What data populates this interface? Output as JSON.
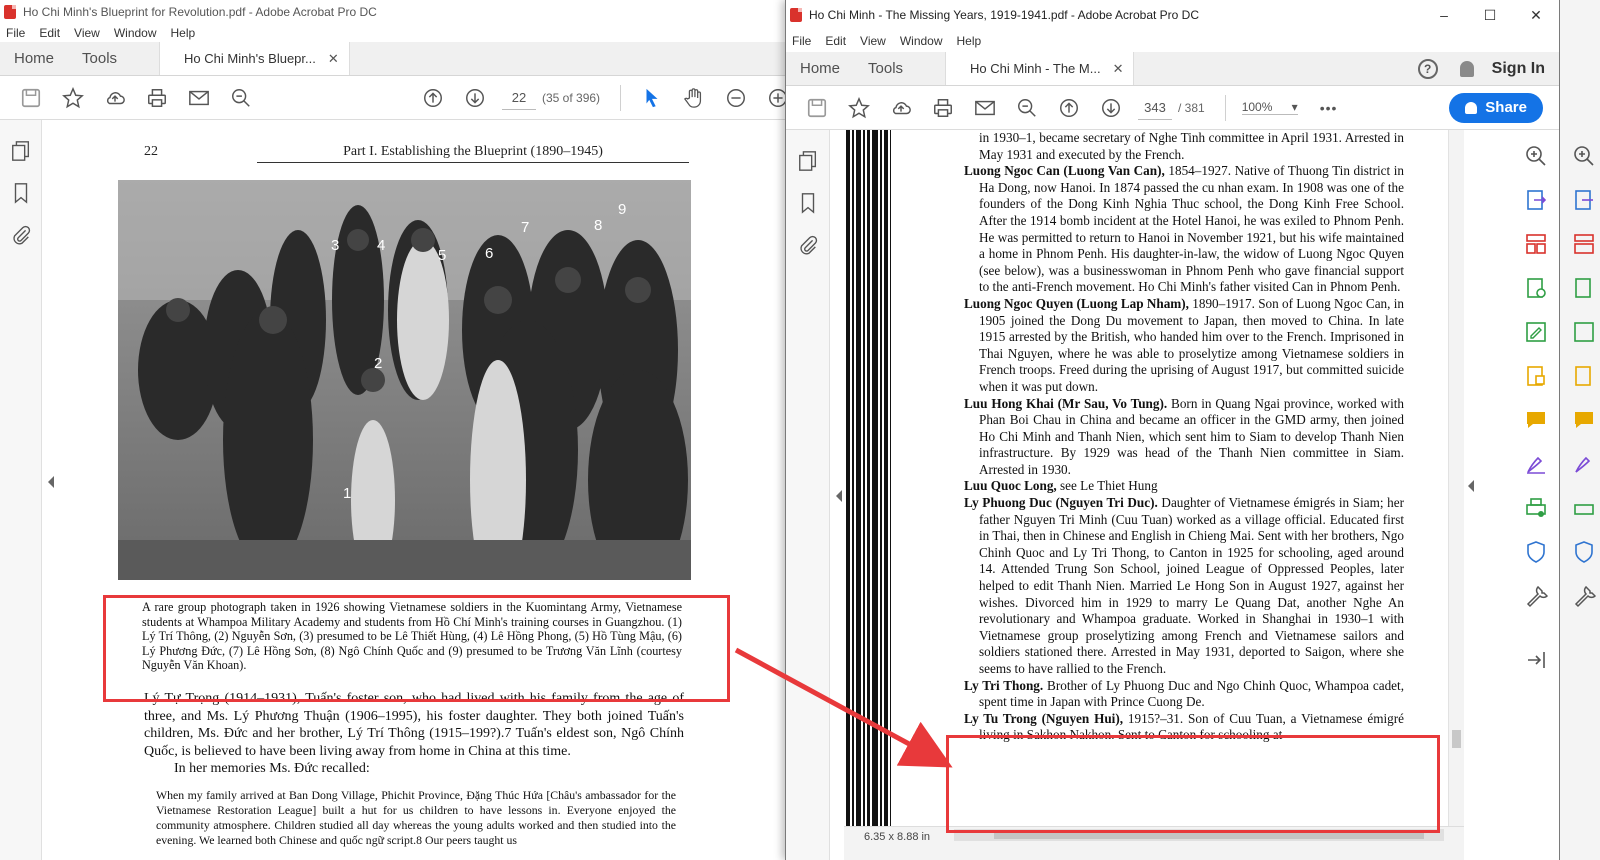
{
  "left_window": {
    "title": "Ho Chi Minh's Blueprint for Revolution.pdf - Adobe Acrobat Pro DC",
    "menu": [
      "File",
      "Edit",
      "View",
      "Window",
      "Help"
    ],
    "tabs": {
      "home": "Home",
      "tools": "Tools",
      "document": "Ho Chi Minh's Bluepr..."
    },
    "page_input": "22",
    "page_count": "(35 of 396)",
    "page": {
      "page_number": "22",
      "running_head": "Part I. Establishing the Blueprint (1890–1945)",
      "photo_labels": [
        "1",
        "2",
        "3",
        "4",
        "5",
        "6",
        "7",
        "8",
        "9"
      ],
      "caption": "A rare group photograph taken in 1926 showing Vietnamese soldiers in the Kuomintang Army, Vietnamese students at Whampoa Military Academy and students from Hồ Chí Minh's training courses in Guangzhou. (1) Lý Trí Thông, (2) Nguyễn Sơn, (3) presumed to be Lê Thiết Hùng, (4) Lê Hồng Phong, (5) Hồ Tùng Mậu, (6) Lý Phương Đức, (7) Lê Hồng Sơn, (8) Ngô Chính Quốc and (9) presumed to be Trương Văn Lĩnh (courtesy Nguyễn Văn Khoan).",
      "para1": "Lý Tự Trọng (1914–1931), Tuấn's foster son, who had lived with his family from the age of three, and Ms. Lý Phương Thuận (1906–1995), his foster daughter. They both joined Tuấn's children, Ms. Đức and her brother, Lý Trí Thông (1915–199?).7 Tuấn's eldest son, Ngô Chính Quốc, is believed to have been living away from home in China at this time.",
      "para2": "In her memories Ms. Đức recalled:",
      "quote": "When my family arrived at Ban Dong Village, Phichit Province, Đặng Thúc Hứa [Châu's ambassador for the Vietnamese Restoration League] built a hut for us children to have lessons in. Everyone enjoyed the community atmosphere. Children studied all day whereas the young adults worked and then studied into the evening. We learned both Chinese and quốc ngữ script.8 Our peers taught us"
    }
  },
  "right_window": {
    "title": "Ho Chi Minh - The Missing Years, 1919-1941.pdf - Adobe Acrobat Pro DC",
    "window_controls": [
      "–",
      "☐",
      "✕"
    ],
    "menu": [
      "File",
      "Edit",
      "View",
      "Window",
      "Help"
    ],
    "tabs": {
      "home": "Home",
      "tools": "Tools",
      "document": "Ho Chi Minh - The M..."
    },
    "help_label": "?",
    "sign_in": "Sign In",
    "page_input": "343",
    "page_total": "/ 381",
    "zoom": "100%",
    "more": "•••",
    "share": "Share",
    "page_size": "6.35 x 8.88 in",
    "entries": [
      {
        "head": "",
        "text": "in 1930–1, became secretary of Nghe Tinh committee in April 1931. Arrested in May 1931 and executed by the French."
      },
      {
        "head": "Luong Ngoc Can (Luong Van Can),",
        "text": " 1854–1927. Native of Thuong Tin district in Ha Dong, now Hanoi. In 1874 passed the cu nhan exam. In 1908 was one of the founders of the Dong Kinh Nghia Thuc school, the Dong Kinh Free School. After the 1914 bomb incident at the Hotel Hanoi, he was exiled to Phnom Penh. He was permitted to return to Hanoi in November 1921, but his wife maintained a home in Phnom Penh. His daughter-in-law, the widow of Luong Ngoc Quyen (see below), was a businesswoman in Phnom Penh who gave financial support to the anti-French movement. Ho Chi Minh's father visited Can in Phnom Penh."
      },
      {
        "head": "Luong Ngoc Quyen (Luong Lap Nham),",
        "text": " 1890–1917. Son of Luong Ngoc Can, in 1905 joined the Dong Du movement to Japan, then moved to China. In late 1915 arrested by the British, who handed him over to the French. Imprisoned in Thai Nguyen, where he was able to proselytize among Vietnamese soldiers in French troops. Freed during the uprising of August 1917, but committed suicide when it was put down."
      },
      {
        "head": "Luu Hong Khai (Mr Sau, Vo Tung).",
        "text": " Born in Quang Ngai province, worked with Phan Boi Chau in China and became an officer in the GMD army, then joined Ho Chi Minh and Thanh Nien, which sent him to Siam to develop Thanh Nien infrastructure. By 1929 was head of the Thanh Nien committee in Siam. Arrested in 1930."
      },
      {
        "head": "Luu Quoc Long,",
        "text": " see Le Thiet Hung"
      },
      {
        "head": "Ly Phuong Duc (Nguyen Tri Duc).",
        "text": " Daughter of Vietnamese émigrés in Siam; her father Nguyen Tri Minh (Cuu Tuan) worked as a village official. Educated first in Thai, then in Chinese and English in Chieng Mai. Sent with her brothers, Ngo Chinh Quoc and Ly Tri Thong, to Canton in 1925 for schooling, aged around 14. Attended Trung Son School, joined League of Oppressed Peoples, later helped to edit Thanh Nien. Married Le Hong Son in August 1927, against her wishes. Divorced him in 1929 to marry Le Quang Dat, another Nghe An revolutionary and Whampoa graduate. Worked in Shanghai in 1930–1 with Vietnamese group proselytizing among French and Vietnamese sailors and soldiers stationed there. Arrested in May 1931, deported to Saigon, where she seems to have rallied to the French."
      },
      {
        "head": "Ly Tri Thong.",
        "text": " Brother of Ly Phuong Duc and Ngo Chinh Quoc, Whampoa cadet, spent time in Japan with Prince Cuong De."
      },
      {
        "head": "Ly Tu Trong (Nguyen Hui),",
        "text": " 1915?–31. Son of Cuu Tuan, a Vietnamese émigré living in Sakhon Nakhon. Sent to Canton for schooling at"
      }
    ]
  },
  "colors": {
    "annotation_red": "#e8393b",
    "share_blue": "#1473e6",
    "pdf_red": "#d9322c",
    "tool_purple": "#7b4bd6",
    "tool_green": "#2f9e44",
    "tool_yellow": "#e7a800",
    "tool_blue": "#2f74d0"
  }
}
